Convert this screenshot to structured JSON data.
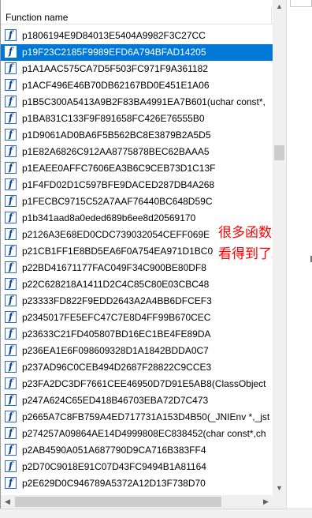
{
  "header": {
    "column_label": "Function name"
  },
  "functions": [
    "p1806194E9D84013E5404A9982F3C27CC",
    "p19F23C2185F9989EFD6A794BFAD14205",
    "p1A1AAC575CA7D5F503FC971F9A361182",
    "p1ACF496E46B70DB62167BD0E451E1A06",
    "p1B5C300A5413A9B2F83BA4991EA7B601(uchar const*,",
    "p1BA831C133F9F891658FC426E76555B0",
    "p1D9061AD0BA6F5B562BC8E3879B2A5D5",
    "p1E82A6826C912AA8775878BEC62BAAA5",
    "p1EAEE0AFFC7606EA3B6C9CEB73D1C13F",
    "p1F4FD02D1C597BFE9DACED287DB4A268",
    "p1FECBC9715C52A7AAF76440BC648D59C",
    "p1b341aad8a0eded689b6ee8d20569170",
    "p2126A3E68ED0CDC739032054CEFF069E",
    "p21CB1FF1E8BD5EA6F0A754EA971D1BC0",
    "p22BD41671177FAC049F34C900BE80DF8",
    "p22C628218A1411D2C4C85C80E03CBC48",
    "p23333FD822F9EDD2643A2A4BB6DFCEF3",
    "p2345017FE5EFC47C7E8D4FF99B670CEC",
    "p23633C21FD405807BD16EC1BE4FE89DA",
    "p236EA1E6F098609328D1A1842BDDA0C7",
    "p237AD96C0CEB494D2687F28822C9CCE3",
    "p23FA2DC3DF7661CEE46950D7D91E5AB8(ClassObject",
    "p247A624C65ED418B46703EBA72D7C473",
    "p2665A7C8FB759A4ED717731A153D4B50(_JNIEnv *,_jst",
    "p274257A09864AE14D4999808EC838452(char const*,ch",
    "p2AB4590A051A687790D9CA716B383FF4",
    "p2D70C9018E91C07D43FC9494B1A81164",
    "p2E629D0C946789A5372A12D13F738D70"
  ],
  "selected_index": 1,
  "icon_glyph": "f",
  "overlay_note": {
    "line1": "很多函数都",
    "line2": "看得到了。",
    "color": "#ff0000"
  },
  "scroll_arrows": {
    "up": "▲",
    "down": "▼",
    "left": "◀",
    "right": "▶"
  }
}
